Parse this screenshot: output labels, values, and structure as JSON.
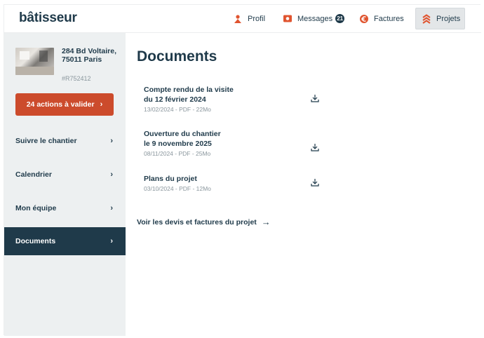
{
  "header": {
    "logo": "bâtisseur",
    "nav": {
      "profil": "Profil",
      "messages": "Messages",
      "messages_count": "21",
      "factures": "Factures",
      "projets": "Projets"
    }
  },
  "sidebar": {
    "project_address": "284 Bd Voltaire, 75011 Paris",
    "project_ref": "#R752412",
    "cta_label": "24 actions à valider",
    "items": [
      {
        "label": "Suivre le chantier"
      },
      {
        "label": "Calendrier"
      },
      {
        "label": "Mon équipe"
      },
      {
        "label": "Documents"
      }
    ]
  },
  "main": {
    "title": "Documents",
    "documents": [
      {
        "name_line1": "Compte rendu de la visite",
        "name_line2": "du 12 février 2024",
        "meta": "13/02/2024 - PDF - 22Mo"
      },
      {
        "name_line1": "Ouverture du chantier",
        "name_line2": "le 9 novembre 2025",
        "meta": "08/11/2024 - PDF - 25Mo"
      },
      {
        "name_line1": "Plans du projet",
        "name_line2": "",
        "meta": "03/10/2024 - PDF - 12Mo"
      }
    ],
    "link_label": "Voir les devis et factures du projet"
  },
  "colors": {
    "brand": "#1f3a4a",
    "accent": "#cc4b2c",
    "muted": "#8a969d",
    "sidebar_bg": "#edf0f1"
  },
  "icons": {
    "profil": "person-icon",
    "messages": "chat-bubble-icon",
    "factures": "euro-icon",
    "projets": "chevrons-up-icon",
    "download": "download-icon",
    "arrow": "arrow-right-icon",
    "chevron": "chevron-right-icon"
  }
}
